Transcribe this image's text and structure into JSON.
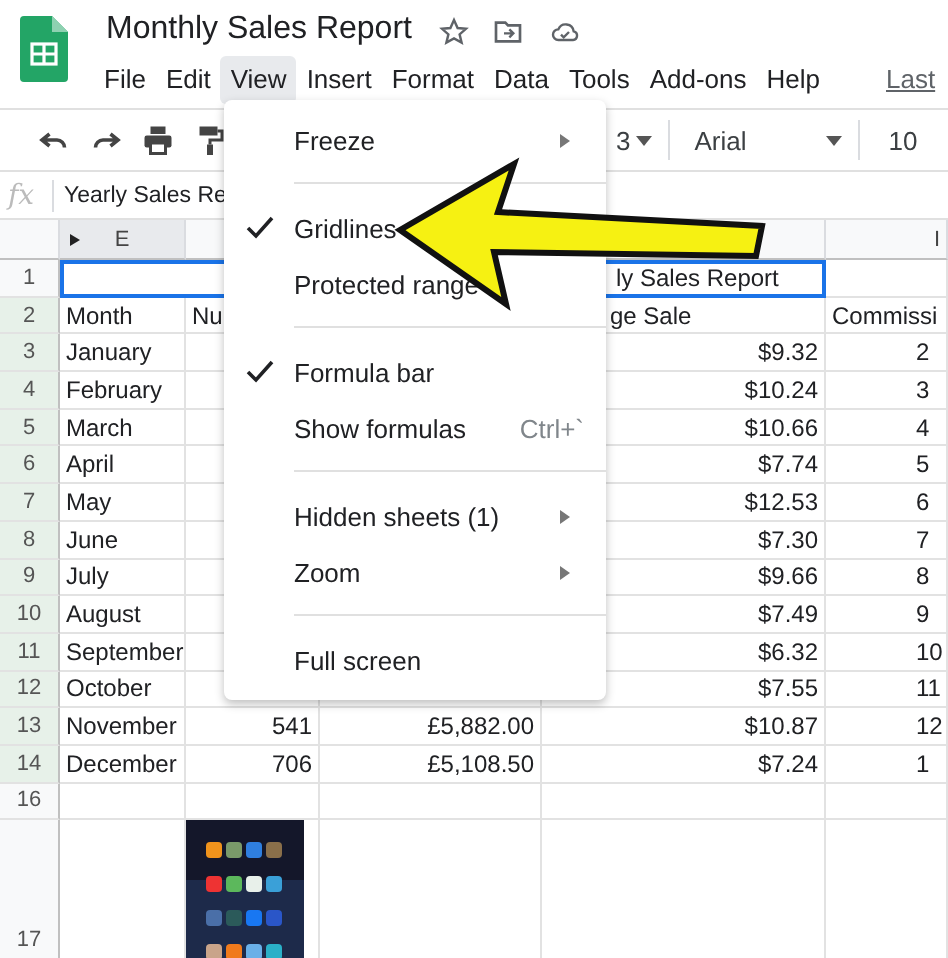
{
  "document": {
    "title": "Monthly Sales Report"
  },
  "menu_bar": [
    {
      "label": "File",
      "selected": false
    },
    {
      "label": "Edit",
      "selected": false
    },
    {
      "label": "View",
      "selected": true
    },
    {
      "label": "Insert",
      "selected": false
    },
    {
      "label": "Format",
      "selected": false
    },
    {
      "label": "Data",
      "selected": false
    },
    {
      "label": "Tools",
      "selected": false
    },
    {
      "label": "Add-ons",
      "selected": false
    },
    {
      "label": "Help",
      "selected": false
    }
  ],
  "last_edit": "Last",
  "toolbar": {
    "zoom_partial": "3",
    "font": "Arial",
    "font_size": "10"
  },
  "formula_bar": {
    "label": "fx",
    "content": "Yearly Sales Re"
  },
  "column_headers": [
    "E",
    "I"
  ],
  "rows": [
    {
      "number": "1",
      "selected": false,
      "kind": "title",
      "cells": {
        "h": "ly Sales Report"
      }
    },
    {
      "number": "2",
      "selected": true,
      "kind": "header",
      "cells": {
        "e": "Month",
        "f": "Nu",
        "h": "ge Sale",
        "i": "Commissi"
      }
    },
    {
      "number": "3",
      "selected": true,
      "kind": "data",
      "cells": {
        "e": "January",
        "h": "$9.32",
        "i": "2"
      }
    },
    {
      "number": "4",
      "selected": true,
      "kind": "data",
      "cells": {
        "e": "February",
        "h": "$10.24",
        "i": "3"
      }
    },
    {
      "number": "5",
      "selected": true,
      "kind": "data",
      "cells": {
        "e": "March",
        "h": "$10.66",
        "i": "4"
      }
    },
    {
      "number": "6",
      "selected": true,
      "kind": "data",
      "cells": {
        "e": "April",
        "h": "$7.74",
        "i": "5"
      }
    },
    {
      "number": "7",
      "selected": true,
      "kind": "data",
      "cells": {
        "e": "May",
        "h": "$12.53",
        "i": "6"
      }
    },
    {
      "number": "8",
      "selected": true,
      "kind": "data",
      "cells": {
        "e": "June",
        "h": "$7.30",
        "i": "7"
      }
    },
    {
      "number": "9",
      "selected": true,
      "kind": "data",
      "cells": {
        "e": "July",
        "h": "$9.66",
        "i": "8"
      }
    },
    {
      "number": "10",
      "selected": true,
      "kind": "data",
      "cells": {
        "e": "August",
        "h": "$7.49",
        "i": "9"
      }
    },
    {
      "number": "11",
      "selected": true,
      "kind": "data",
      "cells": {
        "e": "September",
        "h": "$6.32",
        "i": "10"
      }
    },
    {
      "number": "12",
      "selected": true,
      "kind": "data",
      "cells": {
        "e": "October",
        "h": "$7.55",
        "i": "11"
      }
    },
    {
      "number": "13",
      "selected": true,
      "kind": "data",
      "cells": {
        "e": "November",
        "f": "541",
        "g": "£5,882.00",
        "h": "$10.87",
        "i": "12"
      }
    },
    {
      "number": "14",
      "selected": true,
      "kind": "data",
      "cells": {
        "e": "December",
        "f": "706",
        "g": "£5,108.50",
        "h": "$7.24",
        "i": "1"
      }
    },
    {
      "number": "16",
      "selected": false,
      "kind": "data",
      "cells": {}
    },
    {
      "number": "17",
      "selected": false,
      "kind": "picture",
      "cells": {}
    }
  ],
  "view_menu": [
    {
      "kind": "item",
      "label": "Freeze",
      "checked": false,
      "submenu": true
    },
    {
      "kind": "divider"
    },
    {
      "kind": "item",
      "label": "Gridlines",
      "checked": true,
      "submenu": false
    },
    {
      "kind": "item",
      "label": "Protected range",
      "checked": false,
      "submenu": false
    },
    {
      "kind": "divider"
    },
    {
      "kind": "item",
      "label": "Formula bar",
      "checked": true,
      "submenu": false
    },
    {
      "kind": "item",
      "label": "Show formulas",
      "checked": false,
      "submenu": false,
      "shortcut": "Ctrl+`"
    },
    {
      "kind": "divider"
    },
    {
      "kind": "item",
      "label": "Hidden sheets (1)",
      "checked": false,
      "submenu": true
    },
    {
      "kind": "item",
      "label": "Zoom",
      "checked": false,
      "submenu": true
    },
    {
      "kind": "divider"
    },
    {
      "kind": "item",
      "label": "Full screen",
      "checked": false,
      "submenu": false
    }
  ]
}
